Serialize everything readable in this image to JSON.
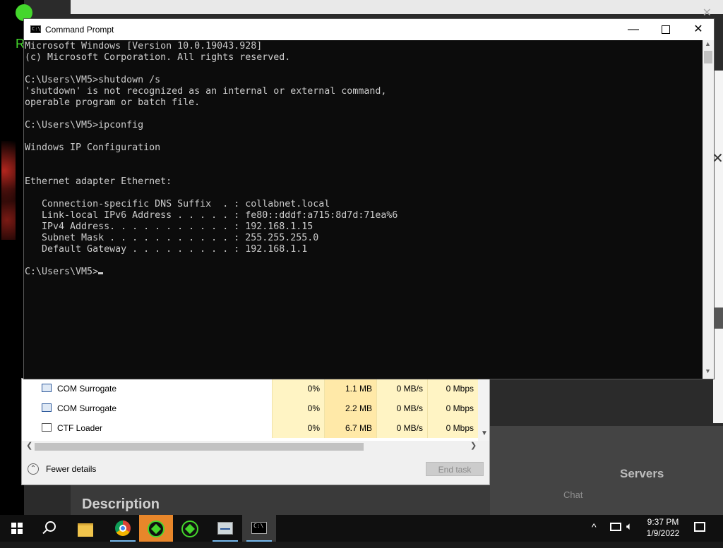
{
  "cmd": {
    "title": "Command Prompt",
    "lines": [
      "Microsoft Windows [Version 10.0.19043.928]",
      "(c) Microsoft Corporation. All rights reserved.",
      "",
      "C:\\Users\\VM5>shutdown /s",
      "'shutdown' is not recognized as an internal or external command,",
      "operable program or batch file.",
      "",
      "C:\\Users\\VM5>ipconfig",
      "",
      "Windows IP Configuration",
      "",
      "",
      "Ethernet adapter Ethernet:",
      "",
      "   Connection-specific DNS Suffix  . : collabnet.local",
      "   Link-local IPv6 Address . . . . . : fe80::dddf:a715:8d7d:71ea%6",
      "   IPv4 Address. . . . . . . . . . . : 192.168.1.15",
      "   Subnet Mask . . . . . . . . . . . : 255.255.255.0",
      "   Default Gateway . . . . . . . . . : 192.168.1.1",
      ""
    ],
    "prompt": "C:\\Users\\VM5>"
  },
  "taskmanager": {
    "rows": [
      {
        "name": "COM Surrogate",
        "cpu": "0%",
        "memory": "1.1 MB",
        "disk": "0 MB/s",
        "network": "0 Mbps"
      },
      {
        "name": "COM Surrogate",
        "cpu": "0%",
        "memory": "2.2 MB",
        "disk": "0 MB/s",
        "network": "0 Mbps"
      },
      {
        "name": "CTF Loader",
        "cpu": "0%",
        "memory": "6.7 MB",
        "disk": "0 MB/s",
        "network": "0 Mbps"
      }
    ],
    "fewer_details": "Fewer details",
    "end_task": "End task"
  },
  "background": {
    "servers": "Servers",
    "chat": "Chat",
    "description": "Description",
    "letter": "R"
  },
  "taskbar": {
    "time": "9:37 PM",
    "date": "1/9/2022"
  },
  "colors": {
    "razer_green": "#44d62c",
    "console_bg": "#0c0c0c",
    "console_text": "#cccccc",
    "taskbar_bg": "#101010"
  }
}
